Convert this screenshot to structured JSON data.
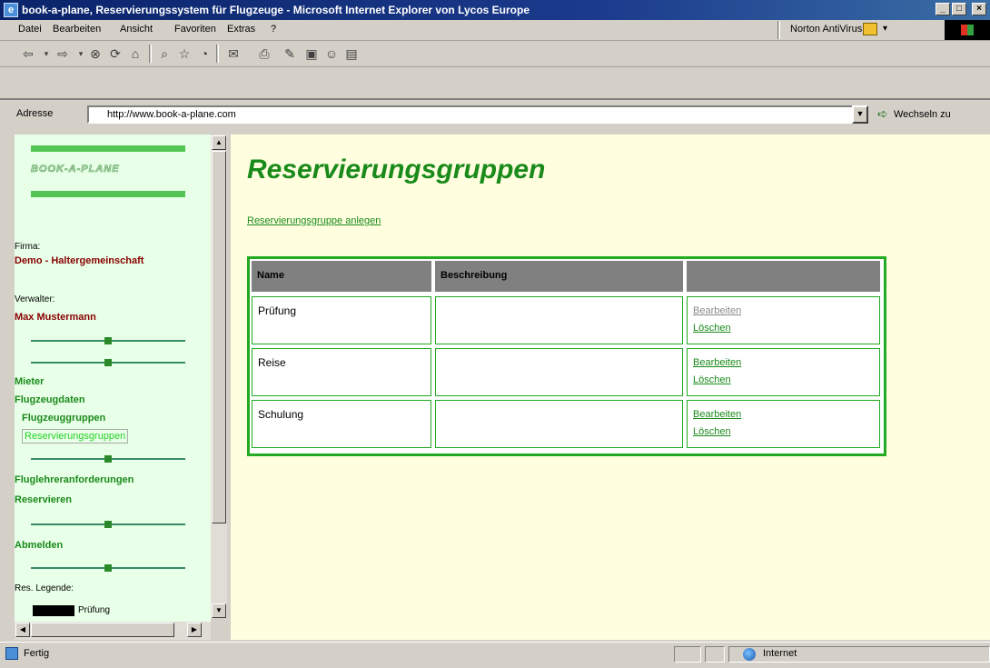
{
  "window": {
    "title": "book-a-plane, Reservierungssystem für Flugzeuge - Microsoft Internet Explorer von Lycos Europe"
  },
  "menu": {
    "items": [
      "Datei",
      "Bearbeiten",
      "Ansicht",
      "Favoriten",
      "Extras",
      "?"
    ],
    "norton": "Norton AntiVirus"
  },
  "address": {
    "label": "Adresse",
    "url": "http://www.book-a-plane.com",
    "go": "Wechseln zu"
  },
  "sidebar": {
    "logo": "BOOK-A-PLANE",
    "firma_label": "Firma:",
    "firma_value": "Demo - Haltergemeinschaft",
    "verwalter_label": "Verwalter:",
    "verwalter_value": "Max Mustermann",
    "mieter": "Mieter",
    "flugzeugdaten": "Flugzeugdaten",
    "flugzeuggruppen": "Flugzeuggruppen",
    "reservierungsgruppen": "Reservierungsgruppen",
    "fluglehrer": "Fluglehreranforderungen",
    "reservieren": "Reservieren",
    "abmelden": "Abmelden",
    "legend_label": "Res. Legende:",
    "legend_item": "Prüfung"
  },
  "main": {
    "heading": "Reservierungsgruppen",
    "create_link": "Reservierungsgruppe anlegen",
    "columns": [
      "Name",
      "Beschreibung",
      ""
    ],
    "rows": [
      {
        "name": "Prüfung",
        "desc": "",
        "edit": "Bearbeiten",
        "delete": "Löschen"
      },
      {
        "name": "Reise",
        "desc": "",
        "edit": "Bearbeiten",
        "delete": "Löschen"
      },
      {
        "name": "Schulung",
        "desc": "",
        "edit": "Bearbeiten",
        "delete": "Löschen"
      }
    ]
  },
  "status": {
    "text": "Fertig",
    "zone": "Internet"
  }
}
